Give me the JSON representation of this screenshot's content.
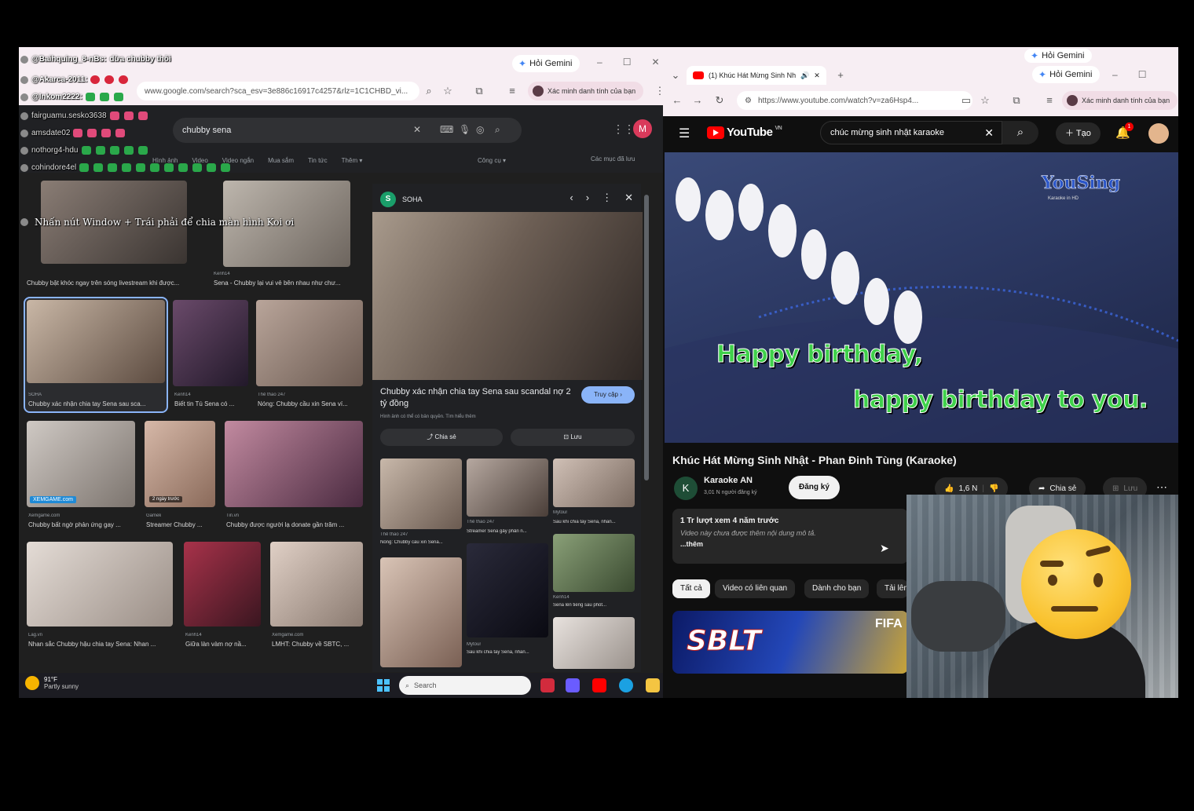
{
  "chat_overlay": {
    "messages": [
      {
        "user": "@Baihquing_8-nBs:",
        "text": "dừa chubby thôi"
      },
      {
        "user": "@Akarca-2011:",
        "text": ""
      },
      {
        "user": "@Inkom2222:",
        "text": ""
      },
      {
        "user": "fairguamu.sesko3638",
        "text": ""
      },
      {
        "user": "amsdate02",
        "text": ""
      },
      {
        "user": "nothorg4-hdu",
        "text": ""
      },
      {
        "user": "cohindore4el",
        "text": ""
      },
      {
        "user": "",
        "text": "Nhấn nút Window + Trái phải để chia màn hình Koi ơi"
      }
    ]
  },
  "left_browser": {
    "gemini_label": "Hỏi Gemini",
    "url": "www.google.com/search?sca_esv=3e886c16917c4257&rlz=1C1CHBD_vi...",
    "verify_label": "Xác minh danh tính của bạn",
    "google": {
      "query": "chubby sena",
      "avatar_letter": "M",
      "tabs": [
        "Hình ảnh",
        "Video",
        "Video ngắn",
        "Mua sắm",
        "Tin tức",
        "Thêm ▾"
      ],
      "tools_label": "Công cụ ▾",
      "saved_label": "Các mục đã lưu"
    },
    "results": [
      {
        "source": "Kenh14",
        "title": "Sena - Chubby lại vui vẻ bên nhau như chư..."
      },
      {
        "source": "",
        "title": "Chubby bật khóc ngay trên sóng livestream khi được..."
      },
      {
        "source": "SOHA",
        "title": "Chubby xác nhận chia tay Sena sau sca..."
      },
      {
        "source": "Kenh14",
        "title": "Biết tin Tú Sena có ..."
      },
      {
        "source": "Thể thao 247",
        "title": "Nóng: Chubby cầu xin Sena ví..."
      },
      {
        "source": "Xemgame.com",
        "title": "Chubby bất ngờ phản ứng gay ..."
      },
      {
        "source": "Gamek",
        "title": "Streamer Chubby ..."
      },
      {
        "source": "Tin.vn",
        "title": "Chubby được người lạ donate gần trăm ..."
      },
      {
        "source": "Lag.vn",
        "title": "Nhan sắc Chubby hậu chia tay Sena: Nhan ..."
      },
      {
        "source": "Kenh14",
        "title": "Giữa làn vàm nợ nầ..."
      },
      {
        "source": "Xemgame.com",
        "title": "LMHT: Chubby về SBTC, ..."
      }
    ],
    "badges": {
      "xemgame": "XEMGAME.com",
      "time_ago": "2 ngày trước"
    },
    "side_panel": {
      "source": "SOHA",
      "title": "Chubby xác nhận chia tay Sena sau scandal nợ 2 tỷ đồng",
      "visit_label": "Truy cập ›",
      "note": "Hình ảnh có thể có bản quyền. Tìm hiểu thêm",
      "share_label": "Chia sẻ",
      "save_label": "Lưu",
      "related": [
        {
          "source": "Thể thao 247",
          "title": "Nóng: Chubby cầu xin Sena..."
        },
        {
          "source": "Thể thao 247",
          "title": "Streamer Sena gây phản n..."
        },
        {
          "source": "Mytour",
          "title": "Sau khi chia tay Sena, nhan..."
        },
        {
          "source": "Kenh14",
          "title": "Sena lên tiếng sau phốt..."
        },
        {
          "source": "Mytour",
          "title": "Sau khi chia tay Sena, nhan..."
        }
      ]
    }
  },
  "taskbar": {
    "temperature": "91°F",
    "weather": "Partly sunny",
    "search_placeholder": "Search"
  },
  "right_browser": {
    "tab_title": "(1) Khúc Hát Mừng Sinh Nh",
    "gemini_label": "Hỏi Gemini",
    "url": "https://www.youtube.com/watch?v=za6Hsp4...",
    "verify_label": "Xác minh danh tính của bạn",
    "youtube": {
      "logo": "YouTube",
      "region": "VN",
      "search_query": "chúc mừng sinh nhật karaoke",
      "create_label": "Tạo",
      "notif_count": "1",
      "video": {
        "lyric_line1": "Happy birthday,",
        "lyric_line2": "happy birthday to you.",
        "watermark": "YouSing",
        "watermark_sub": "Karaoke in HD"
      },
      "title": "Khúc Hát Mừng Sinh Nhật - Phan Đinh Tùng (Karaoke)",
      "channel_name": "Karaoke AN",
      "channel_avatar": "K",
      "subscribers": "3,01 N người đăng ký",
      "subscribe_label": "Đăng ký",
      "likes": "1,6 N",
      "share_label": "Chia sẻ",
      "save_label": "Lưu",
      "description": {
        "stats": "1 Tr lượt xem  4 năm trước",
        "text": "Video này chưa được thêm nội dung mô tả.",
        "more": "...thêm"
      },
      "chips": [
        "Tất cả",
        "Video có liên quan",
        "Dành cho bạn",
        "Tải lên"
      ],
      "ad_text": "SBLT",
      "ad_fifa": "FIFA"
    }
  }
}
